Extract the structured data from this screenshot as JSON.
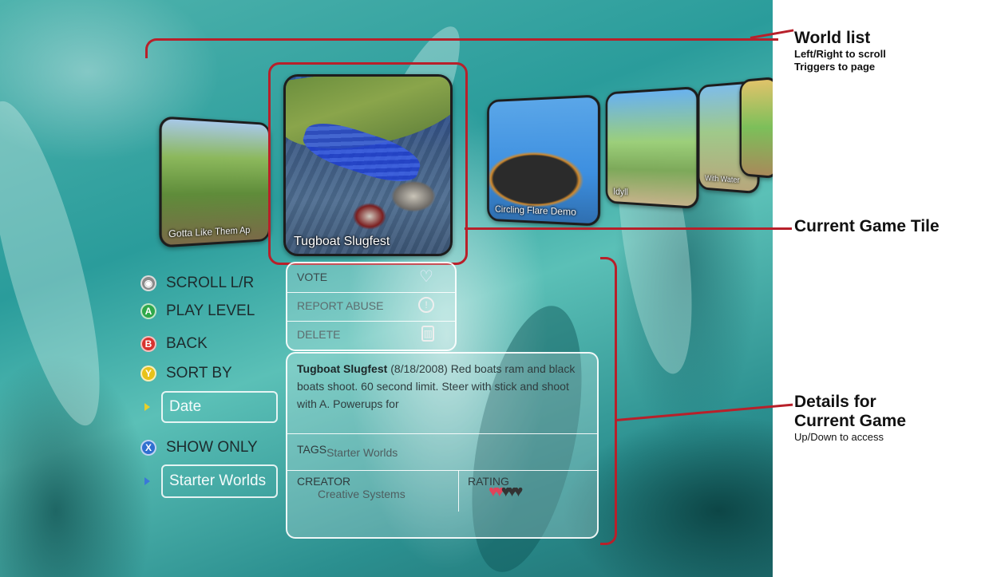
{
  "world_list": {
    "tiles": [
      {
        "caption": "Gotta Like Them Ap"
      },
      {
        "caption": "Tugboat Slugfest"
      },
      {
        "caption": "Circling Flare Demo"
      },
      {
        "caption": "Idyll"
      },
      {
        "caption": "With Water"
      }
    ]
  },
  "actions": {
    "vote": "VOTE",
    "report_abuse": "REPORT ABUSE",
    "delete": "DELETE",
    "icons": [
      "heart-icon",
      "exclamation-icon",
      "trash-icon"
    ]
  },
  "details": {
    "title": "Tugboat Slugfest",
    "date": "(8/18/2008)",
    "description": "Red boats ram and black boats shoot. 60 second limit. Steer with stick and shoot with A. Powerups for",
    "tags_label": "TAGS",
    "tags_value": "Starter Worlds",
    "creator_label": "CREATOR",
    "creator_value": "Creative Systems",
    "rating_label": "RATING",
    "rating": 2,
    "rating_max": 5
  },
  "menu": {
    "scroll": "SCROLL L/R",
    "play": "PLAY LEVEL",
    "back": "BACK",
    "sort_by": "SORT BY",
    "sort_value": "Date",
    "show_only": "SHOW ONLY",
    "show_value": "Starter Worlds",
    "button_letters": [
      "A",
      "B",
      "Y",
      "X"
    ],
    "button_colors": {
      "A": "#2fa84a",
      "B": "#d8322e",
      "Y": "#e8c21a",
      "X": "#2f6fd0",
      "stick": "#8a8a8a"
    }
  },
  "annotations": {
    "world_list_title": "World list",
    "world_list_line1": "Left/Right to scroll",
    "world_list_line2": "Triggers to page",
    "current_tile": "Current Game Tile",
    "details_title_1": "Details for",
    "details_title_2": "Current Game",
    "details_sub": "Up/Down to access"
  },
  "colors": {
    "annotation_red": "#b8202a",
    "heart_red": "#e0445a",
    "heart_dark": "#333333"
  }
}
